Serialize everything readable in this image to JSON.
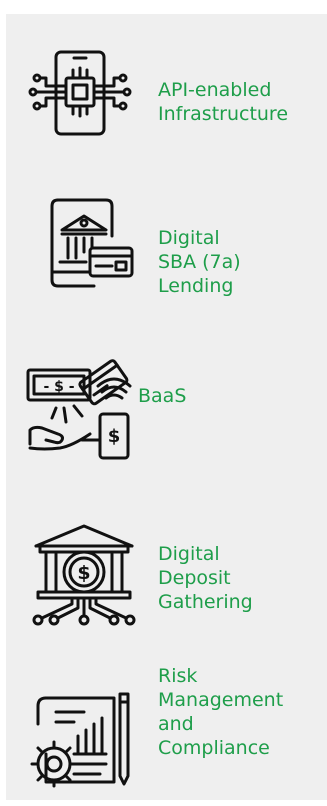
{
  "accent_color": "#1e9e4a",
  "items": [
    {
      "icon": "chip-circuit-icon",
      "label": "API-enabled\nInfrastructure"
    },
    {
      "icon": "bank-card-phone-icon",
      "label": "Digital\nSBA (7a)\nLending"
    },
    {
      "icon": "payment-transfer-icon",
      "label": "BaaS"
    },
    {
      "icon": "bank-coin-circuit-icon",
      "label": "Digital\nDeposit\nGathering"
    },
    {
      "icon": "report-gear-chart-icon",
      "label": "Risk\nManagement\nand\nCompliance"
    }
  ]
}
